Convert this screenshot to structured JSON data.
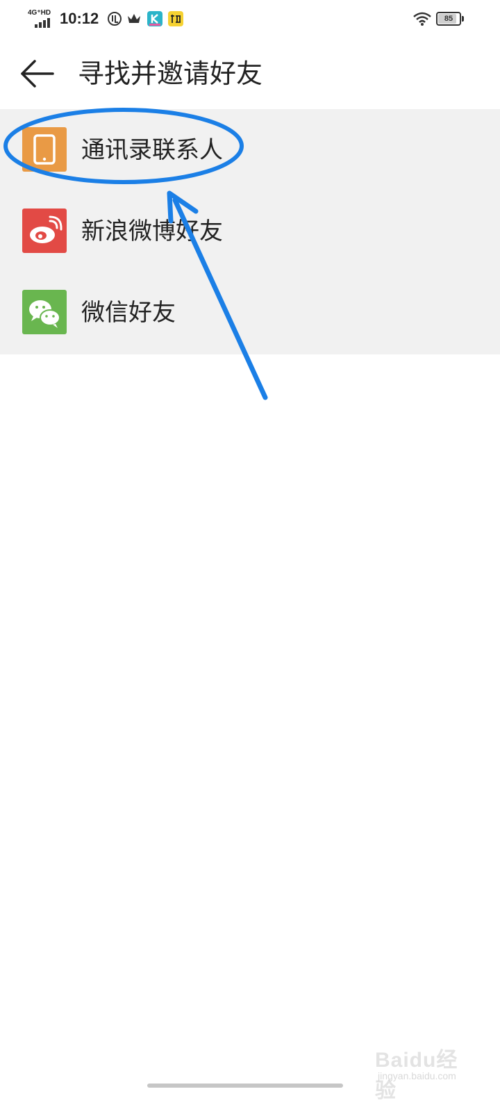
{
  "status_bar": {
    "network": "4G⁺HD",
    "time": "10:12",
    "battery": "85",
    "battery_level": 0.85,
    "icons": [
      "signal-icon",
      "data-saver-icon",
      "crown-icon",
      "k-app-icon",
      "kuaidi-app-icon",
      "wifi-icon",
      "battery-icon"
    ]
  },
  "header": {
    "back_icon": "arrow-left-icon",
    "title": "寻找并邀请好友"
  },
  "invite_options": [
    {
      "label": "通讯录联系人",
      "icon": "phone-icon",
      "color": "#e99a45"
    },
    {
      "label": "新浪微博好友",
      "icon": "weibo-icon",
      "color": "#e24a45"
    },
    {
      "label": "微信好友",
      "icon": "wechat-icon",
      "color": "#69b64f"
    }
  ],
  "annotation": {
    "color": "#1b7fe6",
    "shapes": [
      "ellipse-highlight",
      "arrow"
    ]
  },
  "watermark": {
    "brand": "Baidu经验",
    "url": "jingyan.baidu.com"
  },
  "colors": {
    "list_background": "#f1f1f1",
    "page_background": "#ffffff"
  }
}
